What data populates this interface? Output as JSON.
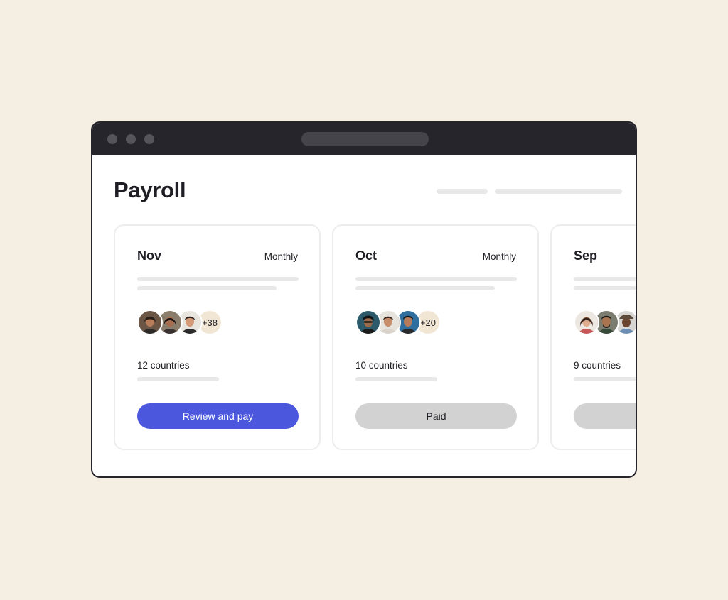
{
  "page": {
    "title": "Payroll"
  },
  "colors": {
    "background": "#f5eee2",
    "window_chrome": "#26252b",
    "primary_button": "#4b58dd",
    "paid_button": "#d3d2d2",
    "avatar_more_bg": "#f1e6d4"
  },
  "window": {
    "traffic_lights": [
      "window-dot",
      "window-dot",
      "window-dot"
    ]
  },
  "cards": [
    {
      "month": "Nov",
      "frequency": "Monthly",
      "avatars": [
        "person-avatar",
        "person-avatar",
        "person-avatar"
      ],
      "more_count": "+38",
      "countries": "12 countries",
      "button_label": "Review and pay",
      "status": "unpaid"
    },
    {
      "month": "Oct",
      "frequency": "Monthly",
      "avatars": [
        "person-avatar",
        "person-avatar",
        "person-avatar"
      ],
      "more_count": "+20",
      "countries": "10 countries",
      "button_label": "Paid",
      "status": "paid"
    },
    {
      "month": "Sep",
      "avatars": [
        "person-avatar",
        "person-avatar",
        "person-avatar"
      ],
      "countries": "9 countries",
      "status": "paid"
    }
  ]
}
